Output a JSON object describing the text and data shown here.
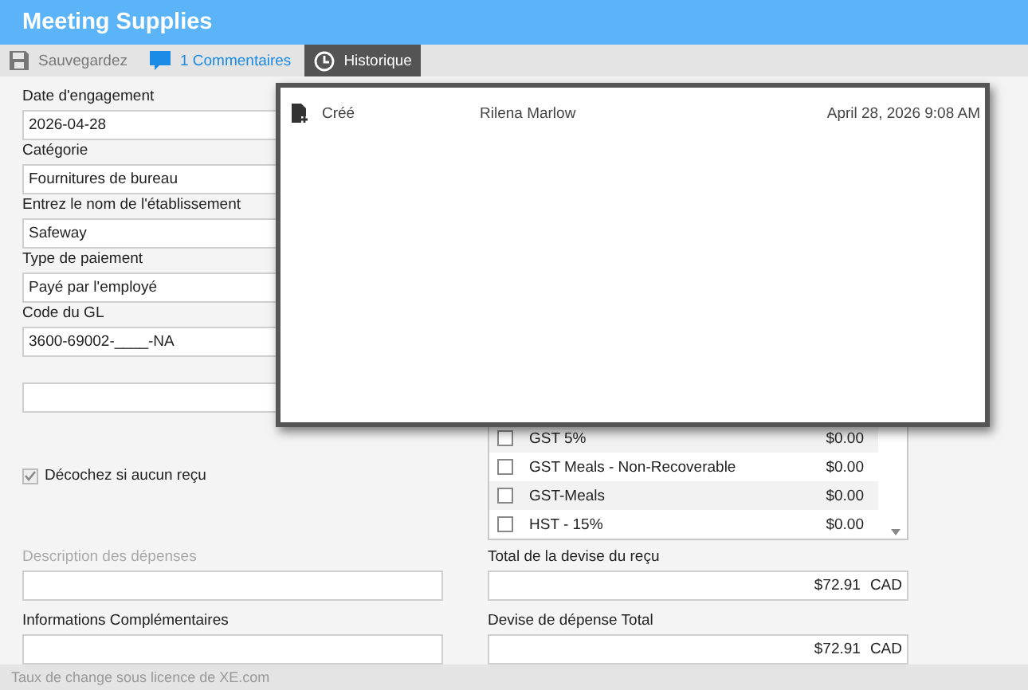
{
  "window": {
    "title": "Meeting Supplies"
  },
  "toolbar": [
    {
      "kind": "save",
      "label": "Sauvegardez",
      "selected": false
    },
    {
      "kind": "comments",
      "label": "1 Commentaires",
      "selected": false
    },
    {
      "kind": "history",
      "label": "Historique",
      "selected": true
    }
  ],
  "fields": [
    {
      "label": "Date d'engagement",
      "value": "2026-04-28"
    },
    {
      "label": "Catégorie",
      "value": "Fournitures de bureau"
    },
    {
      "label": "Entrez le nom de l'établissement",
      "value": "Safeway"
    },
    {
      "label": "Type de paiement",
      "value": "Payé par l'employé"
    },
    {
      "label": "Code du GL",
      "value": "3600-69002-____-NA"
    }
  ],
  "receipt_checkbox": {
    "label": "Décochez si aucun reçu",
    "checked": true,
    "disabled": true
  },
  "taxes": [
    {
      "name": "GST 5%",
      "amount": "$0.00",
      "checked": false
    },
    {
      "name": "GST Meals - Non-Recoverable",
      "amount": "$0.00",
      "checked": false
    },
    {
      "name": "GST-Meals",
      "amount": "$0.00",
      "checked": false
    },
    {
      "name": "HST - 15%",
      "amount": "$0.00",
      "checked": false
    }
  ],
  "description": {
    "label": "Description des dépenses",
    "disabled": true
  },
  "additional_info": {
    "label": "Informations Complémentaires"
  },
  "receipt_total": {
    "label": "Total de la devise du reçu",
    "amount": "$72.91",
    "currency": "CAD"
  },
  "expense_total": {
    "label": "Devise de dépense Total",
    "amount": "$72.91",
    "currency": "CAD"
  },
  "history_panel": {
    "entries": [
      {
        "action": "Créé",
        "user": "Rilena Marlow",
        "time": "April 28, 2026 9:08 AM"
      }
    ]
  },
  "footer": {
    "text": "Taux de change sous licence de XE.com"
  }
}
